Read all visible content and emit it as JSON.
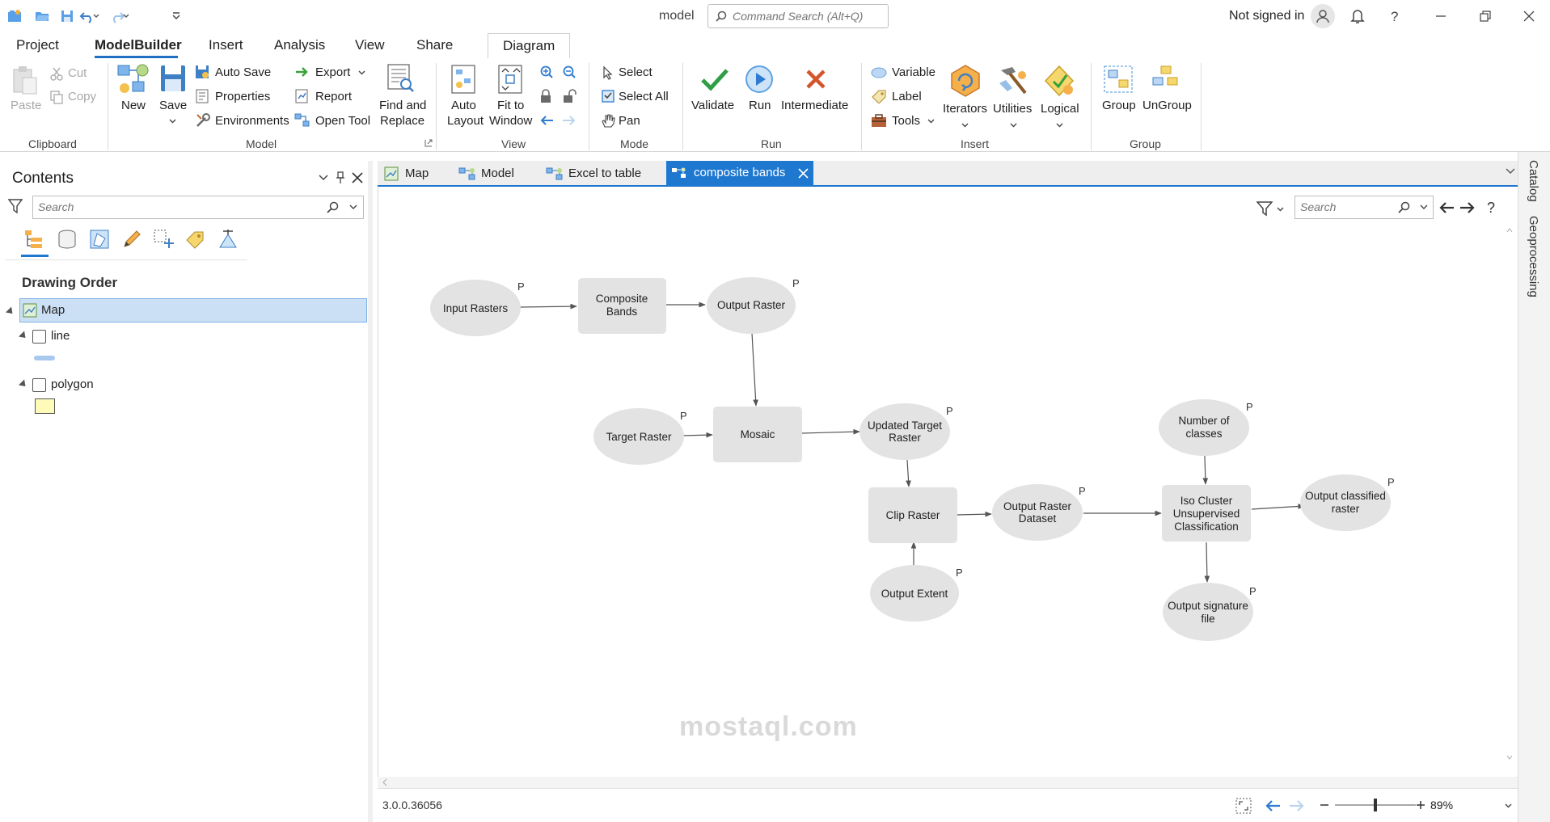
{
  "titlebar": {
    "title": "model",
    "command_search_placeholder": "Command Search (Alt+Q)",
    "user_status": "Not signed in"
  },
  "ribbon_tabs": [
    "Project",
    "ModelBuilder",
    "Insert",
    "Analysis",
    "View",
    "Share",
    "Diagram"
  ],
  "ribbon": {
    "clipboard": {
      "paste": "Paste",
      "cut": "Cut",
      "copy": "Copy",
      "group": "Clipboard"
    },
    "model": {
      "new": "New",
      "save": "Save",
      "auto_save": "Auto Save",
      "properties": "Properties",
      "environments": "Environments",
      "export": "Export",
      "report": "Report",
      "open_tool": "Open Tool",
      "find_replace_1": "Find and",
      "find_replace_2": "Replace",
      "group": "Model"
    },
    "view": {
      "auto_layout_1": "Auto",
      "auto_layout_2": "Layout",
      "fit_1": "Fit to",
      "fit_2": "Window",
      "group": "View"
    },
    "mode": {
      "select": "Select",
      "select_all": "Select All",
      "pan": "Pan",
      "group": "Mode"
    },
    "run": {
      "validate": "Validate",
      "run": "Run",
      "intermediate": "Intermediate",
      "group": "Run"
    },
    "insert": {
      "variable": "Variable",
      "label": "Label",
      "tools": "Tools",
      "iterators": "Iterators",
      "utilities": "Utilities",
      "logical": "Logical",
      "group": "Insert"
    },
    "group_grp": {
      "group": "Group",
      "ungroup": "UnGroup",
      "group_label": "Group"
    }
  },
  "contents": {
    "title": "Contents",
    "search_placeholder": "Search",
    "section": "Drawing Order",
    "map": "Map",
    "layers": [
      {
        "name": "line",
        "checked": false,
        "swatch": "#a8c8ee"
      },
      {
        "name": "polygon",
        "checked": false,
        "swatch": "#fdfbb7"
      }
    ]
  },
  "doc_tabs": [
    "Map",
    "Model",
    "Excel to table",
    "composite bands"
  ],
  "canvas": {
    "search_placeholder": "Search",
    "version": "3.0.0.36056",
    "zoom": "89%"
  },
  "right_rail": [
    "Catalog",
    "Geoprocessing"
  ],
  "diagram": {
    "param_marker": "P",
    "nodes": {
      "input_rasters": "Input Rasters",
      "composite_bands_1": "Composite",
      "composite_bands_2": "Bands",
      "output_raster": "Output Raster",
      "target_raster": "Target Raster",
      "mosaic": "Mosaic",
      "updated_target_1": "Updated Target",
      "updated_target_2": "Raster",
      "clip_raster": "Clip Raster",
      "output_extent": "Output Extent",
      "output_raster_dataset_1": "Output Raster",
      "output_raster_dataset_2": "Dataset",
      "number_classes_1": "Number of",
      "number_classes_2": "classes",
      "iso_1": "Iso Cluster",
      "iso_2": "Unsupervised",
      "iso_3": "Classification",
      "output_classified_1": "Output classified",
      "output_classified_2": "raster",
      "output_signature_1": "Output signature",
      "output_signature_2": "file"
    }
  },
  "watermark": "mostaql.com"
}
